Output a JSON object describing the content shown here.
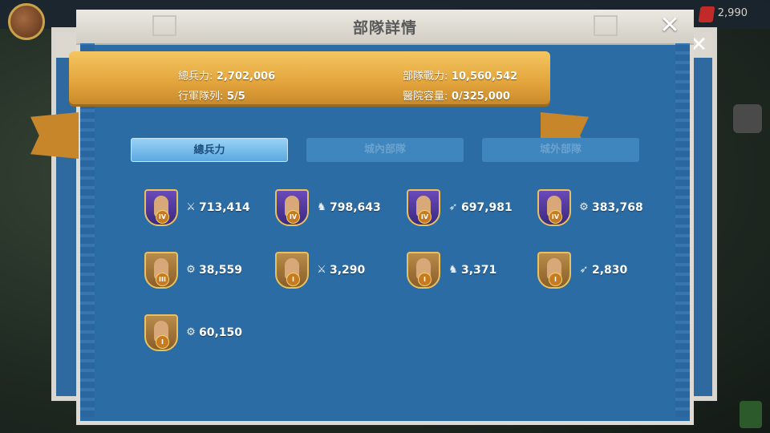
{
  "background": {
    "gem_count": "2,990"
  },
  "panel": {
    "title": "部隊詳情",
    "close_glyph": "✕"
  },
  "stats": {
    "total_troops_label": "總兵力:",
    "total_troops_value": "2,702,006",
    "march_queue_label": "行軍隊列:",
    "march_queue_value": "5/5",
    "power_label": "部隊戰力:",
    "power_value": "10,560,542",
    "hospital_label": "醫院容量:",
    "hospital_value": "0/325,000"
  },
  "tabs": [
    {
      "label": "總兵力",
      "active": true
    },
    {
      "label": "城內部隊",
      "active": false
    },
    {
      "label": "城外部隊",
      "active": false
    }
  ],
  "troops": [
    {
      "rank": "IV",
      "type_icon": "sword-icon",
      "glyph": "⚔",
      "count": "713,414"
    },
    {
      "rank": "IV",
      "type_icon": "horse-icon",
      "glyph": "♞",
      "count": "798,643"
    },
    {
      "rank": "IV",
      "type_icon": "bow-icon",
      "glyph": "➶",
      "count": "697,981"
    },
    {
      "rank": "IV",
      "type_icon": "siege-icon",
      "glyph": "⚙",
      "count": "383,768"
    },
    {
      "rank": "III",
      "type_icon": "siege-icon",
      "glyph": "⚙",
      "count": "38,559"
    },
    {
      "rank": "I",
      "type_icon": "sword-icon",
      "glyph": "⚔",
      "count": "3,290"
    },
    {
      "rank": "I",
      "type_icon": "horse-icon",
      "glyph": "♞",
      "count": "3,371"
    },
    {
      "rank": "I",
      "type_icon": "bow-icon",
      "glyph": "➶",
      "count": "2,830"
    },
    {
      "rank": "I",
      "type_icon": "siege-icon",
      "glyph": "⚙",
      "count": "60,150"
    }
  ]
}
